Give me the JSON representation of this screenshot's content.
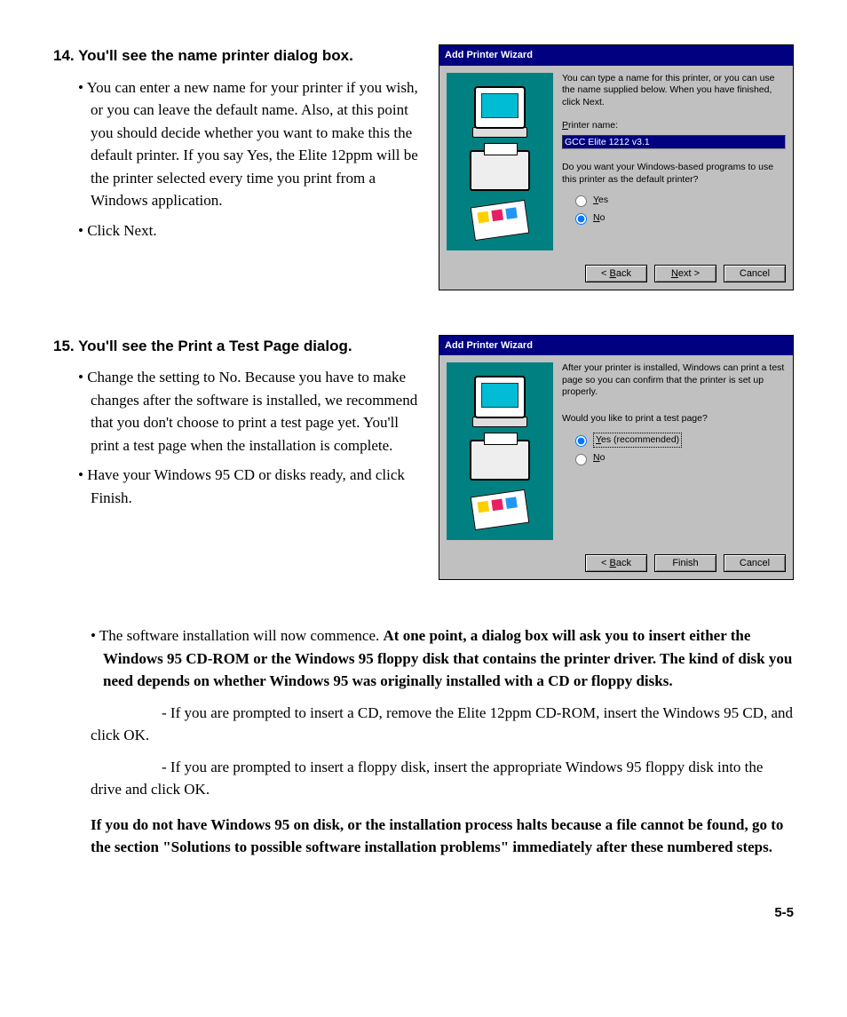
{
  "step14": {
    "num": "14.",
    "heading": "You'll see the name printer dialog box.",
    "bullet1": "You can enter a new name for your printer if you wish, or you can leave the default name. Also, at this point you should decide whether you want to make this the default printer. If you say Yes, the Elite 12ppm will be the printer selected every time you print from a Windows application.",
    "bullet2": "Click Next."
  },
  "step15": {
    "num": "15.",
    "heading": "You'll see the Print a Test Page dialog.",
    "bullet1": "Change the setting to No. Because you have to make changes after the software is installed, we recommend that you don't choose to print a test page yet. You'll print a test page when the installation is complete.",
    "bullet2": "Have your Windows 95 CD or disks ready, and click Finish."
  },
  "below": {
    "b1_plain": "The software installation will now commence. ",
    "b1_bold": "At one point, a dialog box will ask you to insert either the Windows 95 CD-ROM or the Windows 95 floppy disk that contains the printer driver. The kind of disk you need depends on whether Windows 95 was originally installed with a CD or floppy disks.",
    "dash1": "- If you are prompted to insert a CD, remove the Elite 12ppm CD-ROM, insert the Windows 95 CD, and click OK.",
    "dash2": "- If you are prompted to insert a floppy disk, insert the appropriate Windows 95 floppy disk into the drive and click OK.",
    "bold2": "If you do not have Windows 95 on disk, or the installation process halts because a file cannot be found, go to the section \"Solutions to possible software installation problems\" immediately after these numbered steps."
  },
  "dialog1": {
    "title": "Add Printer Wizard",
    "instr": "You can type a name for this printer, or you can use the name supplied below. When you have finished, click Next.",
    "name_label": "Printer name:",
    "name_value": "GCC Elite 1212 v3.1",
    "question": "Do you want your Windows-based programs to use this printer as the default printer?",
    "yes": "Yes",
    "no": "No",
    "back": "< Back",
    "next": "Next >",
    "cancel": "Cancel"
  },
  "dialog2": {
    "title": "Add Printer Wizard",
    "instr": "After your printer is installed, Windows can print a test page so you can confirm that the printer is set up properly.",
    "question": "Would you like to print a test page?",
    "yes": "Yes (recommended)",
    "no": "No",
    "back": "< Back",
    "finish": "Finish",
    "cancel": "Cancel"
  },
  "pagenum": "5-5"
}
